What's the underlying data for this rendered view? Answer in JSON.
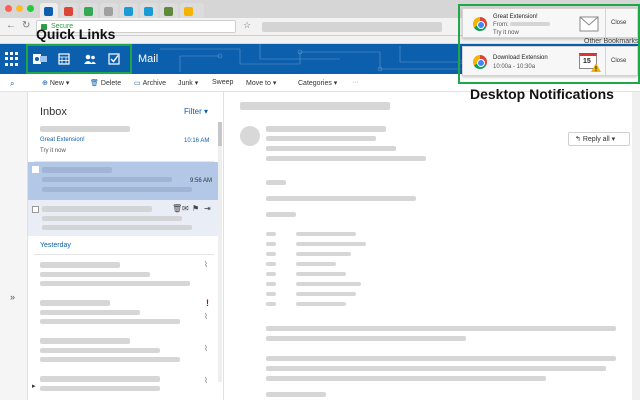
{
  "browser": {
    "url_text": "Secure",
    "bookmarks_text": "Other Bookmarks"
  },
  "header": {
    "app_name": "Mail"
  },
  "annotations": {
    "quick_links": "Quick Links",
    "desktop_notifications": "Desktop Notifications"
  },
  "toolbar": {
    "new": "New",
    "delete": "Delete",
    "archive": "Archive",
    "junk": "Junk",
    "sweep": "Sweep",
    "move_to": "Move to",
    "categories": "Categories"
  },
  "list": {
    "title": "Inbox",
    "filter": "Filter",
    "first_subject": "Great Extension!",
    "first_preview": "Try it now",
    "first_time": "10:16 AM",
    "selected_time": "9:56 AM",
    "group_yesterday": "Yesterday"
  },
  "reading": {
    "reply_all": "Reply all"
  },
  "notifications": [
    {
      "title": "Great Extension!",
      "line1": "From:",
      "line2": "Try it now",
      "close": "Close"
    },
    {
      "title": "Download Extension",
      "line1": "10:00a - 10:30a",
      "close": "Close",
      "calendar_day": "15"
    }
  ],
  "colors": {
    "outlook_blue": "#0c5fad",
    "annotation_green": "#1ea84a",
    "selected_row": "#b3c7e6"
  }
}
